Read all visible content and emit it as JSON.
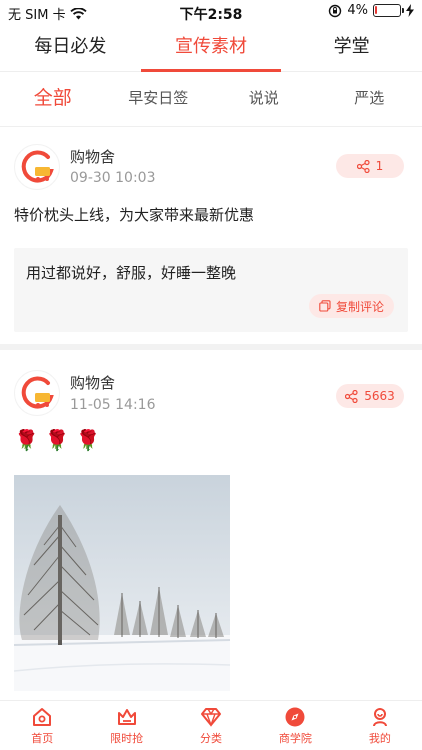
{
  "status_bar": {
    "carrier": "无 SIM 卡",
    "time": "下午2:58",
    "battery_percent": "4%",
    "battery_level": 0.04
  },
  "main_tabs": [
    {
      "label": "每日必发",
      "active": false
    },
    {
      "label": "宣传素材",
      "active": true
    },
    {
      "label": "学堂",
      "active": false
    }
  ],
  "sub_tabs": [
    {
      "label": "全部",
      "active": true
    },
    {
      "label": "早安日签",
      "active": false
    },
    {
      "label": "说说",
      "active": false
    },
    {
      "label": "严选",
      "active": false
    }
  ],
  "posts": [
    {
      "author": "购物舍",
      "time": "09-30 10:03",
      "share_count": "1",
      "text": "特价枕头上线，为大家带来最新优惠",
      "comment": "用过都说好，舒服，好睡一整晚",
      "copy_comment_label": "复制评论"
    },
    {
      "author": "购物舍",
      "time": "11-05 14:16",
      "share_count": "5663",
      "text": "🌹🌹🌹",
      "photo_icon": "snowy-trees-photo"
    }
  ],
  "bottom_nav": [
    {
      "label": "首页",
      "icon": "home-icon"
    },
    {
      "label": "限时抢",
      "icon": "crown-icon"
    },
    {
      "label": "分类",
      "icon": "diamond-icon"
    },
    {
      "label": "商学院",
      "icon": "compass-icon"
    },
    {
      "label": "我的",
      "icon": "user-icon"
    }
  ],
  "colors": {
    "accent": "#f04a3a",
    "accent_light": "#fde8e6",
    "muted": "#999999"
  }
}
